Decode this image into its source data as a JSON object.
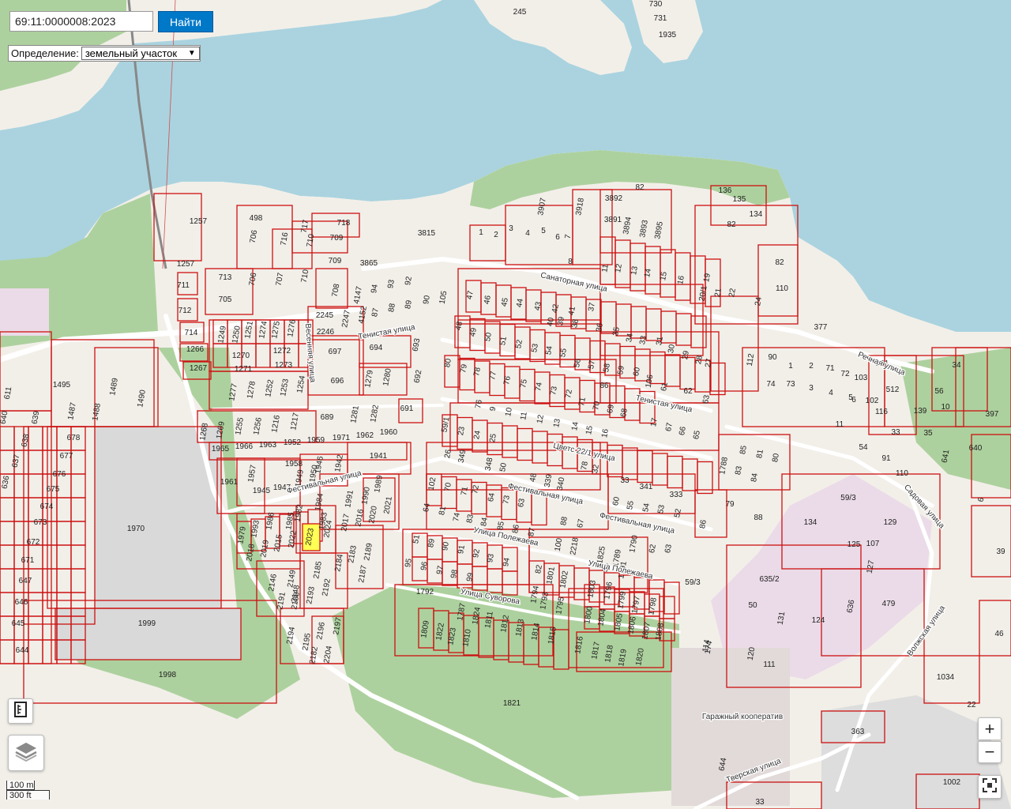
{
  "search": {
    "value": "69:11:0000008:2023",
    "button_label": "Найти"
  },
  "definition": {
    "label": "Определение:",
    "selected": "земельный участок"
  },
  "controls": {
    "zoom_in": "+",
    "zoom_out": "−"
  },
  "scale": {
    "metric": "100 m",
    "imperial": "300 ft"
  },
  "colors": {
    "water": "#aad3df",
    "land": "#f2efe9",
    "forest": "#add19e",
    "parcel_stroke": "#cc1111",
    "selected_parcel": "#ffff55",
    "industrial": "#ebdbe8",
    "button": "#0078c8"
  },
  "streets": [
    {
      "name": "Санаторная улица"
    },
    {
      "name": "Тенистая улица"
    },
    {
      "name": "Тенистая улица"
    },
    {
      "name": "Фестивальная улица"
    },
    {
      "name": "Фестивальная улица"
    },
    {
      "name": "Фестивальная улица"
    },
    {
      "name": "Цветс 22/1 улица"
    },
    {
      "name": "Улица Полежаева"
    },
    {
      "name": "Улица Полежаева"
    },
    {
      "name": "Улица Суворова"
    },
    {
      "name": "Речная улица"
    },
    {
      "name": "Садовая улица"
    },
    {
      "name": "Волжская улица"
    },
    {
      "name": "Тверская улица"
    },
    {
      "name": "Весенняя улица"
    },
    {
      "name": "Гаражный кооператив"
    }
  ],
  "parcels": [
    {
      "n": "245"
    },
    {
      "n": "730"
    },
    {
      "n": "731"
    },
    {
      "n": "1935"
    },
    {
      "n": "1257"
    },
    {
      "n": "498"
    },
    {
      "n": "706"
    },
    {
      "n": "716"
    },
    {
      "n": "717"
    },
    {
      "n": "718"
    },
    {
      "n": "710"
    },
    {
      "n": "709"
    },
    {
      "n": "709"
    },
    {
      "n": "1257"
    },
    {
      "n": "713"
    },
    {
      "n": "706"
    },
    {
      "n": "707"
    },
    {
      "n": "710"
    },
    {
      "n": "705"
    },
    {
      "n": "711"
    },
    {
      "n": "712"
    },
    {
      "n": "714"
    },
    {
      "n": "1266"
    },
    {
      "n": "1267"
    },
    {
      "n": "3815"
    },
    {
      "n": "3865"
    },
    {
      "n": "708"
    },
    {
      "n": "4147"
    },
    {
      "n": "94"
    },
    {
      "n": "93"
    },
    {
      "n": "92"
    },
    {
      "n": "88"
    },
    {
      "n": "89"
    },
    {
      "n": "90"
    },
    {
      "n": "105"
    },
    {
      "n": "87"
    },
    {
      "n": "4152"
    },
    {
      "n": "2245"
    },
    {
      "n": "2247"
    },
    {
      "n": "2246"
    },
    {
      "n": "1249"
    },
    {
      "n": "1250"
    },
    {
      "n": "1251"
    },
    {
      "n": "1274"
    },
    {
      "n": "1275"
    },
    {
      "n": "1276"
    },
    {
      "n": "1270"
    },
    {
      "n": "1272"
    },
    {
      "n": "1271"
    },
    {
      "n": "1273"
    },
    {
      "n": "1277"
    },
    {
      "n": "1278"
    },
    {
      "n": "1252"
    },
    {
      "n": "1253"
    },
    {
      "n": "1254"
    },
    {
      "n": "697"
    },
    {
      "n": "696"
    },
    {
      "n": "694"
    },
    {
      "n": "693"
    },
    {
      "n": "692"
    },
    {
      "n": "1279"
    },
    {
      "n": "1280"
    },
    {
      "n": "691"
    },
    {
      "n": "689"
    },
    {
      "n": "1281"
    },
    {
      "n": "1282"
    },
    {
      "n": "1495"
    },
    {
      "n": "1489"
    },
    {
      "n": "1490"
    },
    {
      "n": "1487"
    },
    {
      "n": "1488"
    },
    {
      "n": "611"
    },
    {
      "n": "640"
    },
    {
      "n": "639"
    },
    {
      "n": "638"
    },
    {
      "n": "637"
    },
    {
      "n": "636"
    },
    {
      "n": "678"
    },
    {
      "n": "677"
    },
    {
      "n": "676"
    },
    {
      "n": "675"
    },
    {
      "n": "674"
    },
    {
      "n": "673"
    },
    {
      "n": "672"
    },
    {
      "n": "671"
    },
    {
      "n": "647"
    },
    {
      "n": "646"
    },
    {
      "n": "645"
    },
    {
      "n": "644"
    },
    {
      "n": "1268"
    },
    {
      "n": "1269"
    },
    {
      "n": "1255"
    },
    {
      "n": "1256"
    },
    {
      "n": "1216"
    },
    {
      "n": "1217"
    },
    {
      "n": "1965"
    },
    {
      "n": "1966"
    },
    {
      "n": "1963"
    },
    {
      "n": "1952"
    },
    {
      "n": "1959"
    },
    {
      "n": "1971"
    },
    {
      "n": "1962"
    },
    {
      "n": "1960"
    },
    {
      "n": "1958"
    },
    {
      "n": "1946"
    },
    {
      "n": "1942"
    },
    {
      "n": "1941"
    },
    {
      "n": "1957"
    },
    {
      "n": "1961"
    },
    {
      "n": "1945"
    },
    {
      "n": "1947"
    },
    {
      "n": "1949"
    },
    {
      "n": "1950"
    },
    {
      "n": "1989"
    },
    {
      "n": "1984"
    },
    {
      "n": "1991"
    },
    {
      "n": "1990"
    },
    {
      "n": "2021"
    },
    {
      "n": "1983"
    },
    {
      "n": "2017"
    },
    {
      "n": "2016"
    },
    {
      "n": "2020"
    },
    {
      "n": "1982"
    },
    {
      "n": "1985"
    },
    {
      "n": "2024"
    },
    {
      "n": "1986"
    },
    {
      "n": "1993"
    },
    {
      "n": "1979"
    },
    {
      "n": "2018"
    },
    {
      "n": "2019"
    },
    {
      "n": "2015"
    },
    {
      "n": "2022"
    },
    {
      "n": "2023"
    },
    {
      "n": "1970"
    },
    {
      "n": "1999"
    },
    {
      "n": "1998"
    },
    {
      "n": "2183"
    },
    {
      "n": "2189"
    },
    {
      "n": "2184"
    },
    {
      "n": "2187"
    },
    {
      "n": "2185"
    },
    {
      "n": "2192"
    },
    {
      "n": "2146"
    },
    {
      "n": "2149"
    },
    {
      "n": "2148"
    },
    {
      "n": "2193"
    },
    {
      "n": "2191"
    },
    {
      "n": "2188"
    },
    {
      "n": "2197"
    },
    {
      "n": "2196"
    },
    {
      "n": "2194"
    },
    {
      "n": "2195"
    },
    {
      "n": "2182"
    },
    {
      "n": "2204"
    },
    {
      "n": "1"
    },
    {
      "n": "2"
    },
    {
      "n": "3"
    },
    {
      "n": "4"
    },
    {
      "n": "5"
    },
    {
      "n": "6"
    },
    {
      "n": "7"
    },
    {
      "n": "8"
    },
    {
      "n": "3907"
    },
    {
      "n": "3918"
    },
    {
      "n": "3892"
    },
    {
      "n": "3891"
    },
    {
      "n": "3894"
    },
    {
      "n": "3893"
    },
    {
      "n": "3895"
    },
    {
      "n": "82"
    },
    {
      "n": "136"
    },
    {
      "n": "135"
    },
    {
      "n": "134"
    },
    {
      "n": "82"
    },
    {
      "n": "82"
    },
    {
      "n": "11"
    },
    {
      "n": "12"
    },
    {
      "n": "13"
    },
    {
      "n": "14"
    },
    {
      "n": "15"
    },
    {
      "n": "16"
    },
    {
      "n": "19"
    },
    {
      "n": "20/1"
    },
    {
      "n": "21"
    },
    {
      "n": "22"
    },
    {
      "n": "24"
    },
    {
      "n": "110"
    },
    {
      "n": "377"
    },
    {
      "n": "47"
    },
    {
      "n": "46"
    },
    {
      "n": "45"
    },
    {
      "n": "44"
    },
    {
      "n": "43"
    },
    {
      "n": "42"
    },
    {
      "n": "41"
    },
    {
      "n": "40"
    },
    {
      "n": "39"
    },
    {
      "n": "38"
    },
    {
      "n": "37"
    },
    {
      "n": "36"
    },
    {
      "n": "35"
    },
    {
      "n": "34"
    },
    {
      "n": "33"
    },
    {
      "n": "31"
    },
    {
      "n": "30"
    },
    {
      "n": "29"
    },
    {
      "n": "28"
    },
    {
      "n": "27"
    },
    {
      "n": "48"
    },
    {
      "n": "49"
    },
    {
      "n": "50"
    },
    {
      "n": "51"
    },
    {
      "n": "52"
    },
    {
      "n": "53"
    },
    {
      "n": "54"
    },
    {
      "n": "55"
    },
    {
      "n": "56"
    },
    {
      "n": "57"
    },
    {
      "n": "58"
    },
    {
      "n": "59"
    },
    {
      "n": "60"
    },
    {
      "n": "106"
    },
    {
      "n": "61"
    },
    {
      "n": "62"
    },
    {
      "n": "63"
    },
    {
      "n": "80"
    },
    {
      "n": "79"
    },
    {
      "n": "78"
    },
    {
      "n": "77"
    },
    {
      "n": "76"
    },
    {
      "n": "75"
    },
    {
      "n": "74"
    },
    {
      "n": "73"
    },
    {
      "n": "72"
    },
    {
      "n": "71"
    },
    {
      "n": "70"
    },
    {
      "n": "69"
    },
    {
      "n": "68"
    },
    {
      "n": "86"
    },
    {
      "n": "112"
    },
    {
      "n": "90"
    },
    {
      "n": "1"
    },
    {
      "n": "2"
    },
    {
      "n": "71"
    },
    {
      "n": "72"
    },
    {
      "n": "103"
    },
    {
      "n": "74"
    },
    {
      "n": "73"
    },
    {
      "n": "3"
    },
    {
      "n": "4"
    },
    {
      "n": "5"
    },
    {
      "n": "6"
    },
    {
      "n": "102"
    },
    {
      "n": "101"
    },
    {
      "n": "512"
    },
    {
      "n": "34"
    },
    {
      "n": "56"
    },
    {
      "n": "10"
    },
    {
      "n": "11"
    },
    {
      "n": "59/1"
    },
    {
      "n": "23"
    },
    {
      "n": "24"
    },
    {
      "n": "25"
    },
    {
      "n": "26"
    },
    {
      "n": "349"
    },
    {
      "n": "348"
    },
    {
      "n": "50"
    },
    {
      "n": "48"
    },
    {
      "n": "339"
    },
    {
      "n": "340"
    },
    {
      "n": "78"
    },
    {
      "n": "32"
    },
    {
      "n": "33"
    },
    {
      "n": "341"
    },
    {
      "n": "333"
    },
    {
      "n": "76"
    },
    {
      "n": "9"
    },
    {
      "n": "10"
    },
    {
      "n": "11"
    },
    {
      "n": "12"
    },
    {
      "n": "13"
    },
    {
      "n": "14"
    },
    {
      "n": "15"
    },
    {
      "n": "16"
    },
    {
      "n": "17"
    },
    {
      "n": "67"
    },
    {
      "n": "66"
    },
    {
      "n": "65"
    },
    {
      "n": "64"
    },
    {
      "n": "81"
    },
    {
      "n": "102"
    },
    {
      "n": "70"
    },
    {
      "n": "71"
    },
    {
      "n": "72"
    },
    {
      "n": "64"
    },
    {
      "n": "73"
    },
    {
      "n": "63"
    },
    {
      "n": "74"
    },
    {
      "n": "83"
    },
    {
      "n": "84"
    },
    {
      "n": "85"
    },
    {
      "n": "86"
    },
    {
      "n": "87"
    },
    {
      "n": "88"
    },
    {
      "n": "67"
    },
    {
      "n": "60"
    },
    {
      "n": "55"
    },
    {
      "n": "54"
    },
    {
      "n": "53"
    },
    {
      "n": "52"
    },
    {
      "n": "51"
    },
    {
      "n": "89"
    },
    {
      "n": "90"
    },
    {
      "n": "91"
    },
    {
      "n": "92"
    },
    {
      "n": "93"
    },
    {
      "n": "94"
    },
    {
      "n": "95"
    },
    {
      "n": "96"
    },
    {
      "n": "97"
    },
    {
      "n": "98"
    },
    {
      "n": "99"
    },
    {
      "n": "100"
    },
    {
      "n": "2218"
    },
    {
      "n": "1825"
    },
    {
      "n": "1789"
    },
    {
      "n": "1790"
    },
    {
      "n": "62"
    },
    {
      "n": "63"
    },
    {
      "n": "66"
    },
    {
      "n": "1791"
    },
    {
      "n": "1792"
    },
    {
      "n": "82"
    },
    {
      "n": "1801"
    },
    {
      "n": "1794"
    },
    {
      "n": "1793"
    },
    {
      "n": "1802"
    },
    {
      "n": "1795"
    },
    {
      "n": "1803"
    },
    {
      "n": "1796"
    },
    {
      "n": "1797"
    },
    {
      "n": "1799"
    },
    {
      "n": "1798"
    },
    {
      "n": "1800"
    },
    {
      "n": "1804"
    },
    {
      "n": "1805"
    },
    {
      "n": "1806"
    },
    {
      "n": "1807"
    },
    {
      "n": "1808"
    },
    {
      "n": "1809"
    },
    {
      "n": "1822"
    },
    {
      "n": "1823"
    },
    {
      "n": "1787"
    },
    {
      "n": "1810"
    },
    {
      "n": "1824"
    },
    {
      "n": "1811"
    },
    {
      "n": "1812"
    },
    {
      "n": "1813"
    },
    {
      "n": "1814"
    },
    {
      "n": "1815"
    },
    {
      "n": "1816"
    },
    {
      "n": "1817"
    },
    {
      "n": "1818"
    },
    {
      "n": "1819"
    },
    {
      "n": "1820"
    },
    {
      "n": "1821"
    },
    {
      "n": "1788"
    },
    {
      "n": "83"
    },
    {
      "n": "84"
    },
    {
      "n": "85"
    },
    {
      "n": "81"
    },
    {
      "n": "80"
    },
    {
      "n": "79"
    },
    {
      "n": "86"
    },
    {
      "n": "88"
    },
    {
      "n": "59/3"
    },
    {
      "n": "59/3"
    },
    {
      "n": "129"
    },
    {
      "n": "134"
    },
    {
      "n": "107"
    },
    {
      "n": "125"
    },
    {
      "n": "127"
    },
    {
      "n": "635/2"
    },
    {
      "n": "114"
    },
    {
      "n": "50"
    },
    {
      "n": "131"
    },
    {
      "n": "124"
    },
    {
      "n": "636"
    },
    {
      "n": "479"
    },
    {
      "n": "120"
    },
    {
      "n": "111"
    },
    {
      "n": "116"
    },
    {
      "n": "139"
    },
    {
      "n": "33"
    },
    {
      "n": "35"
    },
    {
      "n": "54"
    },
    {
      "n": "91"
    },
    {
      "n": "110"
    },
    {
      "n": "641"
    },
    {
      "n": "640"
    },
    {
      "n": "397"
    },
    {
      "n": "6"
    },
    {
      "n": "39"
    },
    {
      "n": "46"
    },
    {
      "n": "1034"
    },
    {
      "n": "22"
    },
    {
      "n": "363"
    },
    {
      "n": "1002"
    },
    {
      "n": "33"
    },
    {
      "n": "644"
    },
    {
      "n": "174"
    },
    {
      "n": "50"
    }
  ]
}
